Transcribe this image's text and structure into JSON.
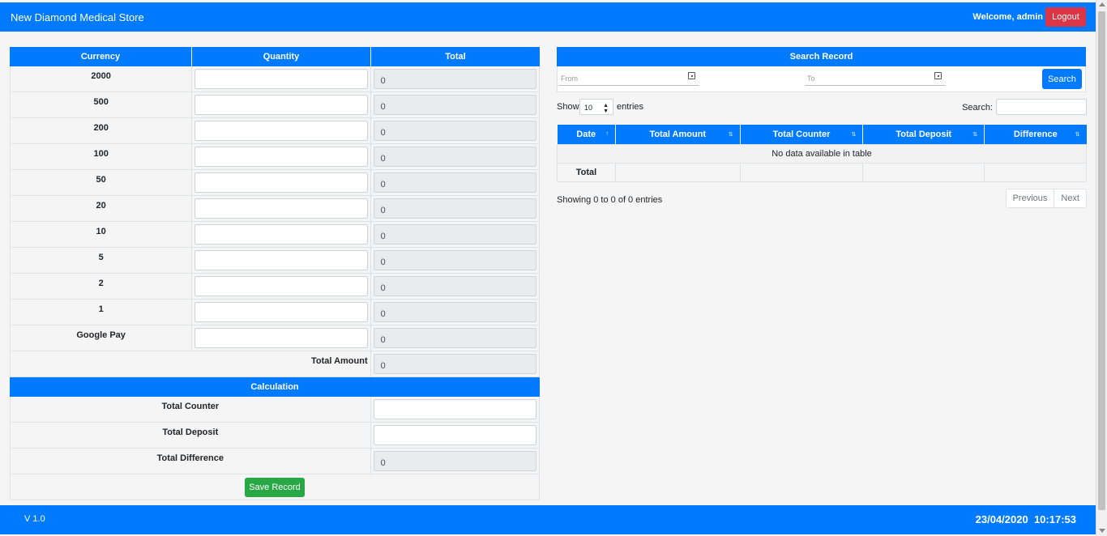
{
  "header": {
    "brand": "New Diamond Medical Store",
    "welcome": "Welcome, admin",
    "logout_label": "Logout"
  },
  "currency_table": {
    "headers": [
      "Currency",
      "Quantity",
      "Total"
    ],
    "rows": [
      {
        "label": "2000",
        "total": "0"
      },
      {
        "label": "500",
        "total": "0"
      },
      {
        "label": "200",
        "total": "0"
      },
      {
        "label": "100",
        "total": "0"
      },
      {
        "label": "50",
        "total": "0"
      },
      {
        "label": "20",
        "total": "0"
      },
      {
        "label": "10",
        "total": "0"
      },
      {
        "label": "5",
        "total": "0"
      },
      {
        "label": "2",
        "total": "0"
      },
      {
        "label": "1",
        "total": "0"
      },
      {
        "label": "Google Pay",
        "total": "0"
      }
    ],
    "total_amount_label": "Total Amount",
    "total_amount_value": "0"
  },
  "calculation": {
    "header": "Calculation",
    "total_counter_label": "Total Counter",
    "total_deposit_label": "Total Deposit",
    "total_difference_label": "Total Difference",
    "total_difference_value": "0",
    "save_label": "Save Record"
  },
  "search_record": {
    "header": "Search Record",
    "from_placeholder": "From",
    "to_placeholder": "To",
    "search_button": "Search"
  },
  "datatable": {
    "show_label": "Show",
    "page_size": "10",
    "entries_label": "entries",
    "search_label": "Search:",
    "columns": [
      "Date",
      "Total Amount",
      "Total Counter",
      "Total Deposit",
      "Difference"
    ],
    "empty_message": "No data available in table",
    "total_label": "Total",
    "info": "Showing 0 to 0 of 0 entries",
    "previous": "Previous",
    "next": "Next"
  },
  "footer": {
    "version": "V 1.0",
    "date": "23/04/2020",
    "time": "10:17:53"
  },
  "colors": {
    "primary": "#007bff",
    "danger": "#dc3545",
    "success": "#28a745"
  }
}
